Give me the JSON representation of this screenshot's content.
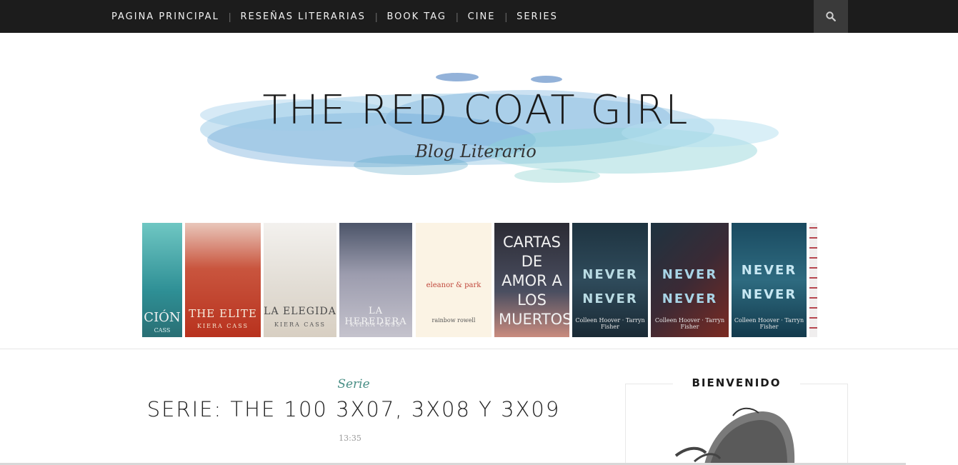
{
  "nav": {
    "items": [
      {
        "label": "PAGINA PRINCIPAL"
      },
      {
        "label": "RESEÑAS LITERARIAS"
      },
      {
        "label": "BOOK TAG"
      },
      {
        "label": "CINE"
      },
      {
        "label": "SERIES"
      }
    ],
    "search_icon": "search-icon"
  },
  "header": {
    "title": "THE RED COAT GIRL",
    "subtitle": "Blog Literario"
  },
  "books": [
    {
      "title": "CIÓN",
      "author": "CASS"
    },
    {
      "title": "THE ELITE",
      "author": "KIERA CASS"
    },
    {
      "title": "LA ELEGIDA",
      "author": "KIERA CASS"
    },
    {
      "title": "LA HEREDERA",
      "author": "KIERA CASS"
    },
    {
      "title": "eleanor & park",
      "author": "rainbow rowell"
    },
    {
      "title": "CARTAS DE AMOR A LOS MUERTOS",
      "author": ""
    },
    {
      "title": "NEVER NEVER",
      "author": "Colleen Hoover · Tarryn Fisher"
    },
    {
      "title": "NEVER NEVER",
      "author": "Colleen Hoover · Tarryn Fisher"
    },
    {
      "title": "NEVER NEVER",
      "author": "Colleen Hoover · Tarryn Fisher"
    }
  ],
  "post": {
    "category": "Serie",
    "title": "SERIE: THE 100 3X07, 3X08 Y 3X09",
    "time": "13:35"
  },
  "sidebar": {
    "widget_title": "BIENVENIDO"
  },
  "colors": {
    "topbar": "#1c1c1c",
    "accent": "#4a8f86"
  }
}
